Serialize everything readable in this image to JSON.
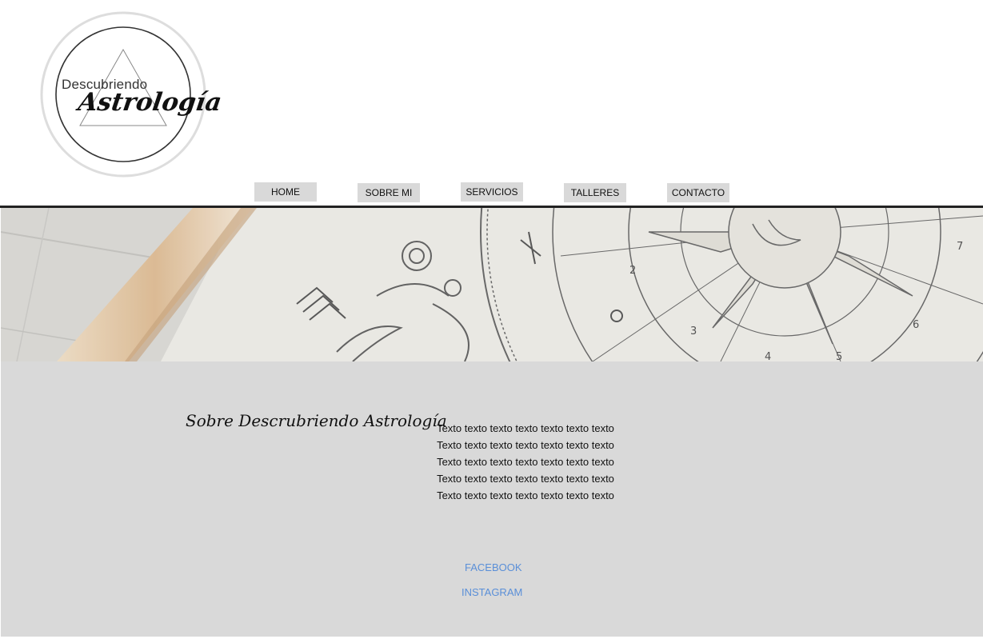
{
  "logo": {
    "line1": "Descubriendo",
    "line2": "Astrología"
  },
  "nav": {
    "items": [
      {
        "label": "HOME"
      },
      {
        "label": "SOBRE MI"
      },
      {
        "label": "SERVICIOS"
      },
      {
        "label": "TALLERES"
      },
      {
        "label": "CONTACTO"
      }
    ]
  },
  "about": {
    "title": "Sobre Descrubriendo Astrología",
    "lines": [
      "Texto texto texto texto texto texto texto",
      "Texto texto texto texto texto texto texto",
      "Texto texto texto texto texto texto texto",
      "Texto texto texto texto texto texto texto",
      "Texto texto texto texto texto texto texto"
    ]
  },
  "social": {
    "facebook": "FACEBOOK",
    "instagram": "INSTAGRAM"
  },
  "colors": {
    "nav_bg": "#d9d9d9",
    "content_bg": "#d9d9d9",
    "link": "#5a8fd8"
  }
}
